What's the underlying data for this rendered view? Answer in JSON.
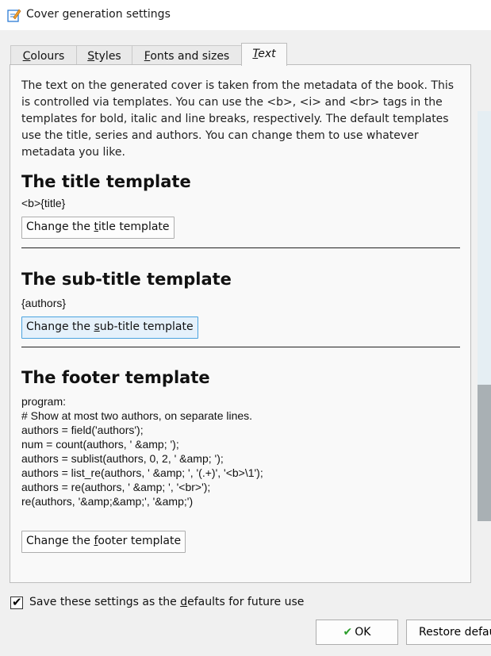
{
  "window": {
    "title": "Cover generation settings",
    "icon": "edit-icon"
  },
  "tabs": [
    {
      "label": "Colours",
      "mnemonic": "C",
      "rest": "olours"
    },
    {
      "label": "Styles",
      "mnemonic": "S",
      "rest": "tyles"
    },
    {
      "label": "Fonts and sizes",
      "mnemonic": "F",
      "rest": "onts and sizes"
    },
    {
      "label": "Text",
      "mnemonic": "T",
      "rest": "ext"
    }
  ],
  "intro": "The text on the generated cover is taken from the metadata of the book. This is controlled via templates. You can use the <b>, <i> and <br> tags in the templates for bold, italic and line breaks, respectively. The default templates use the title, series and authors. You can change them to use whatever metadata you like.",
  "sections": {
    "title": {
      "heading": "The title template",
      "value": "<b>{title}",
      "button": {
        "pre": "Change the ",
        "mn": "t",
        "post": "itle template"
      }
    },
    "subtitle": {
      "heading": "The sub-title template",
      "value": "{authors}",
      "button": {
        "pre": "Change the ",
        "mn": "s",
        "post": "ub-title template"
      }
    },
    "footer": {
      "heading": "The footer template",
      "value": "program:\n# Show at most two authors, on separate lines.\nauthors = field('authors');\nnum = count(authors, ' &amp; ');\nauthors = sublist(authors, 0, 2, ' &amp; ');\nauthors = list_re(authors, ' &amp; ', '(.+)', '<b>\\1');\nauthors = re(authors, ' &amp; ', '<br>');\nre(authors, '&amp;&amp;', '&amp;')",
      "button": {
        "pre": "Change the ",
        "mn": "f",
        "post": "ooter template"
      }
    }
  },
  "save_checkbox": {
    "checked": true,
    "pre": "Save these settings as the ",
    "mn": "d",
    "post": "efaults for future use"
  },
  "buttons": {
    "ok": "OK",
    "restore": "Restore defau"
  },
  "colors": {
    "accent": "#4aa3df",
    "ok_check": "#2a9d2a"
  }
}
